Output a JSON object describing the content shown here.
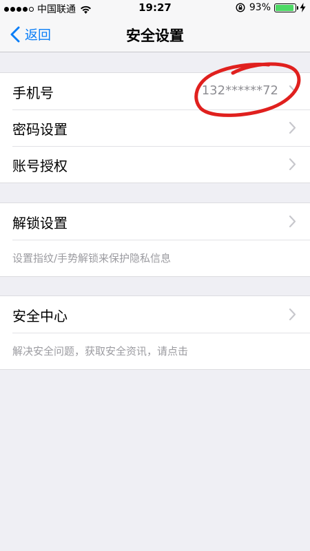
{
  "status_bar": {
    "carrier": "中国联通",
    "time": "19:27",
    "battery_percent": "93%",
    "battery_level": 0.93,
    "battery_color": "#4cd964"
  },
  "nav": {
    "back_label": "返回",
    "title": "安全设置",
    "accent_color": "#0a7ef7"
  },
  "account_group": {
    "phone": {
      "label": "手机号",
      "value": "132******72"
    },
    "password": {
      "label": "密码设置"
    },
    "authorization": {
      "label": "账号授权"
    }
  },
  "unlock_group": {
    "label": "解锁设置",
    "description": "设置指纹/手势解锁来保护隐私信息"
  },
  "security_center_group": {
    "label": "安全中心",
    "description": "解决安全问题，获取安全资讯，请点击"
  },
  "annotation": {
    "color": "#e0201e"
  }
}
